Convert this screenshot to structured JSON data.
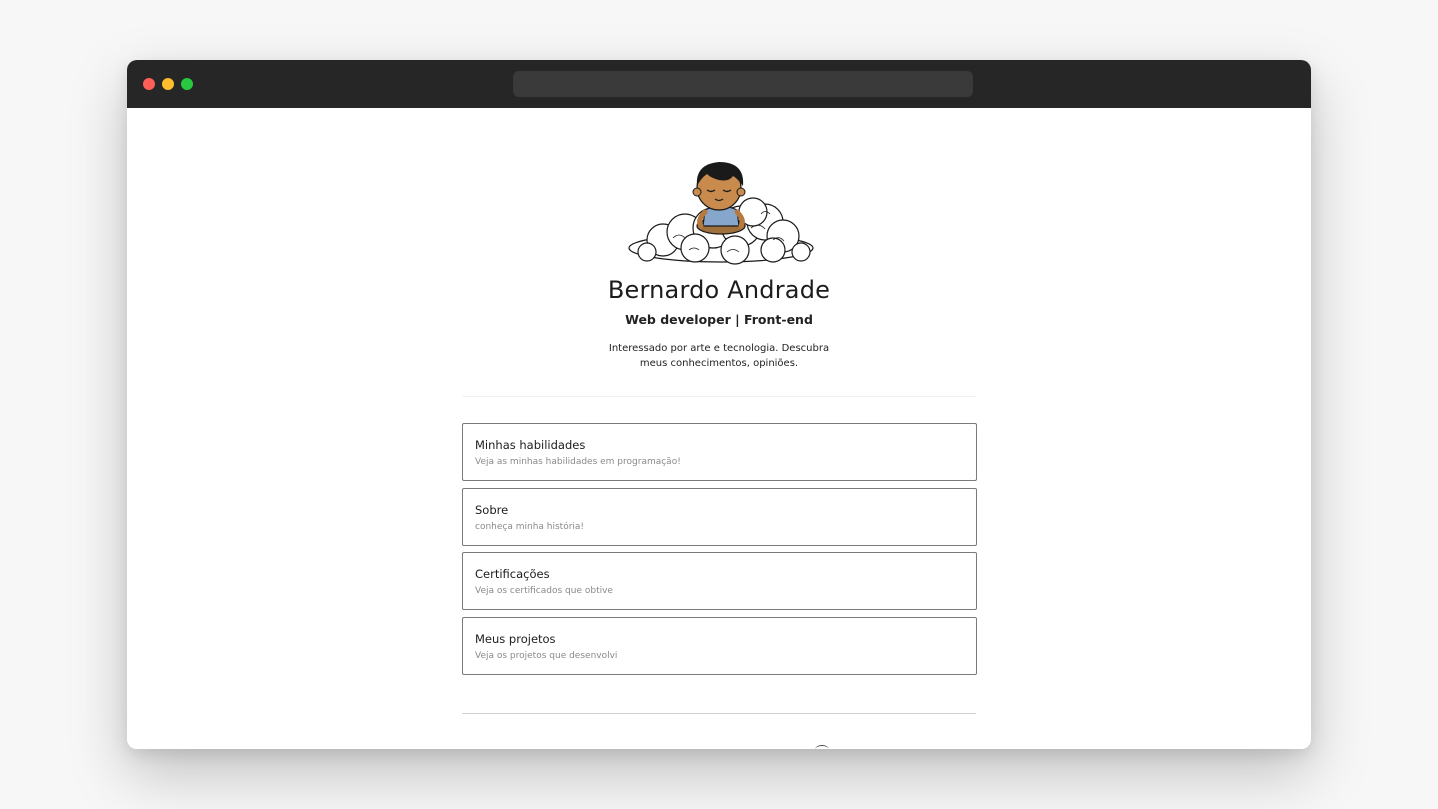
{
  "profile": {
    "name": "Bernardo Andrade",
    "role": "Web developer | Front-end",
    "bio": "Interessado por arte e tecnologia. Descubra meus conhecimentos, opiniões."
  },
  "cards": [
    {
      "title": "Minhas habilidades",
      "subtitle": "Veja as minhas habilidades em programação!"
    },
    {
      "title": "Sobre",
      "subtitle": "conheça minha história!"
    },
    {
      "title": "Certificações",
      "subtitle": "Veja os certificados que obtive"
    },
    {
      "title": "Meus projetos",
      "subtitle": "Veja os projetos que desenvolvi"
    }
  ],
  "colors": {
    "titlebar": "#262626",
    "close": "#ff5f57",
    "minimize": "#febc2e",
    "maximize": "#28c840",
    "card_border": "#7a7a7a"
  },
  "icons": {
    "avatar": "meditating-boy-on-cloud-illustration"
  }
}
